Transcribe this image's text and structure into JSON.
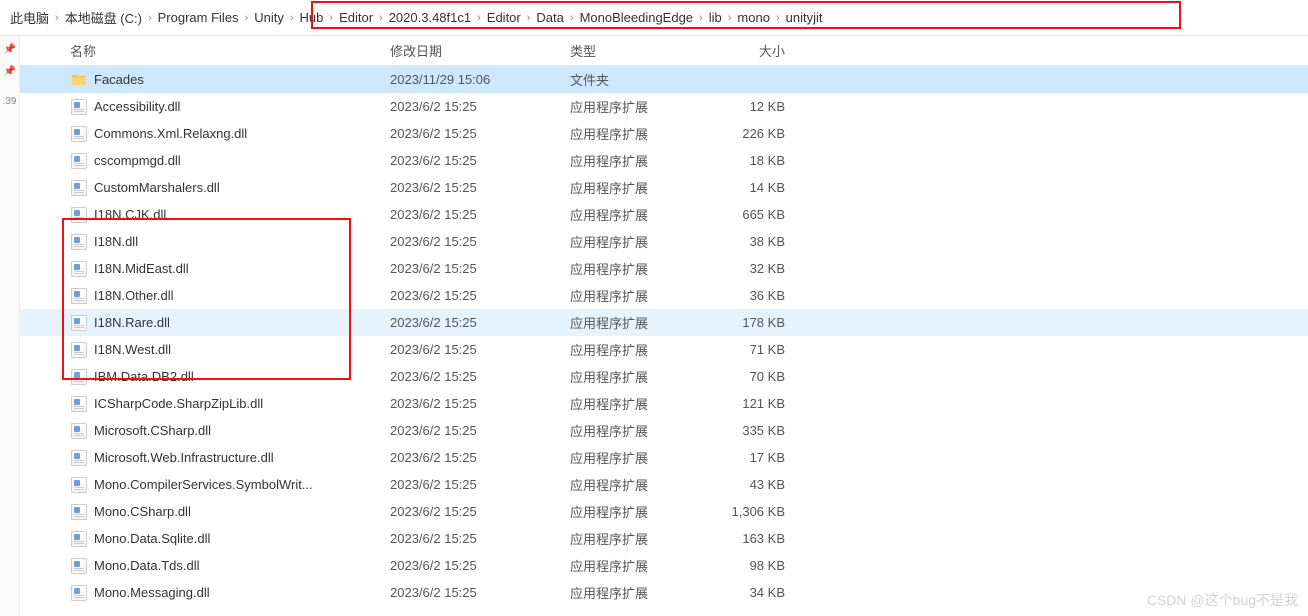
{
  "breadcrumb": {
    "prefix": [
      "此电脑",
      "本地磁盘 (C:)",
      "Program Files"
    ],
    "highlighted": [
      "Unity",
      "Hub",
      "Editor",
      "2020.3.48f1c1",
      "Editor",
      "Data",
      "MonoBleedingEdge",
      "lib",
      "mono",
      "unityjit"
    ]
  },
  "leftGutter": {
    "star": ".39"
  },
  "columns": {
    "name": "名称",
    "date": "修改日期",
    "type": "类型",
    "size": "大小"
  },
  "rows": [
    {
      "icon": "folder",
      "name": "Facades",
      "date": "2023/11/29 15:06",
      "type": "文件夹",
      "size": "",
      "state": "sel"
    },
    {
      "icon": "dll",
      "name": "Accessibility.dll",
      "date": "2023/6/2 15:25",
      "type": "应用程序扩展",
      "size": "12 KB"
    },
    {
      "icon": "dll",
      "name": "Commons.Xml.Relaxng.dll",
      "date": "2023/6/2 15:25",
      "type": "应用程序扩展",
      "size": "226 KB"
    },
    {
      "icon": "dll",
      "name": "cscompmgd.dll",
      "date": "2023/6/2 15:25",
      "type": "应用程序扩展",
      "size": "18 KB"
    },
    {
      "icon": "dll",
      "name": "CustomMarshalers.dll",
      "date": "2023/6/2 15:25",
      "type": "应用程序扩展",
      "size": "14 KB"
    },
    {
      "icon": "dll",
      "name": "I18N.CJK.dll",
      "date": "2023/6/2 15:25",
      "type": "应用程序扩展",
      "size": "665 KB"
    },
    {
      "icon": "dll",
      "name": "I18N.dll",
      "date": "2023/6/2 15:25",
      "type": "应用程序扩展",
      "size": "38 KB"
    },
    {
      "icon": "dll",
      "name": "I18N.MidEast.dll",
      "date": "2023/6/2 15:25",
      "type": "应用程序扩展",
      "size": "32 KB"
    },
    {
      "icon": "dll",
      "name": "I18N.Other.dll",
      "date": "2023/6/2 15:25",
      "type": "应用程序扩展",
      "size": "36 KB"
    },
    {
      "icon": "dll",
      "name": "I18N.Rare.dll",
      "date": "2023/6/2 15:25",
      "type": "应用程序扩展",
      "size": "178 KB",
      "state": "hov"
    },
    {
      "icon": "dll",
      "name": "I18N.West.dll",
      "date": "2023/6/2 15:25",
      "type": "应用程序扩展",
      "size": "71 KB"
    },
    {
      "icon": "dll",
      "name": "IBM.Data.DB2.dll",
      "date": "2023/6/2 15:25",
      "type": "应用程序扩展",
      "size": "70 KB"
    },
    {
      "icon": "dll",
      "name": "ICSharpCode.SharpZipLib.dll",
      "date": "2023/6/2 15:25",
      "type": "应用程序扩展",
      "size": "121 KB"
    },
    {
      "icon": "dll",
      "name": "Microsoft.CSharp.dll",
      "date": "2023/6/2 15:25",
      "type": "应用程序扩展",
      "size": "335 KB"
    },
    {
      "icon": "dll",
      "name": "Microsoft.Web.Infrastructure.dll",
      "date": "2023/6/2 15:25",
      "type": "应用程序扩展",
      "size": "17 KB"
    },
    {
      "icon": "dll",
      "name": "Mono.CompilerServices.SymbolWrit...",
      "date": "2023/6/2 15:25",
      "type": "应用程序扩展",
      "size": "43 KB"
    },
    {
      "icon": "dll",
      "name": "Mono.CSharp.dll",
      "date": "2023/6/2 15:25",
      "type": "应用程序扩展",
      "size": "1,306 KB"
    },
    {
      "icon": "dll",
      "name": "Mono.Data.Sqlite.dll",
      "date": "2023/6/2 15:25",
      "type": "应用程序扩展",
      "size": "163 KB"
    },
    {
      "icon": "dll",
      "name": "Mono.Data.Tds.dll",
      "date": "2023/6/2 15:25",
      "type": "应用程序扩展",
      "size": "98 KB"
    },
    {
      "icon": "dll",
      "name": "Mono.Messaging.dll",
      "date": "2023/6/2 15:25",
      "type": "应用程序扩展",
      "size": "34 KB"
    }
  ],
  "watermark": "CSDN @这个bug不是我"
}
